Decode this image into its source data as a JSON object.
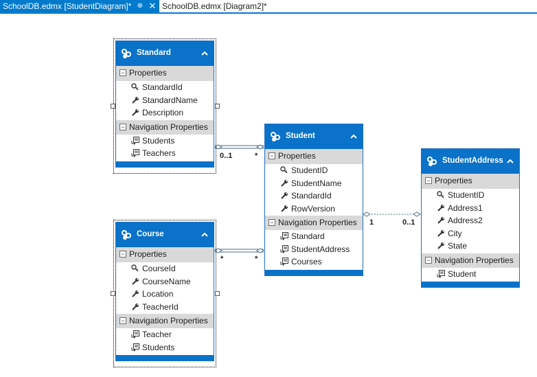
{
  "tabs": {
    "active": {
      "label": "SchoolDB.edmx [StudentDiagram]*",
      "pin_icon": "pin-icon",
      "close_icon": "close-icon"
    },
    "inactive": {
      "label": "SchoolDB.edmx [Diagram2]*"
    }
  },
  "sections": {
    "properties": "Properties",
    "navigation": "Navigation Properties"
  },
  "entities": {
    "standard": {
      "name": "Standard",
      "properties": [
        "StandardId",
        "StandardName",
        "Description"
      ],
      "navigation": [
        "Students",
        "Teachers"
      ]
    },
    "course": {
      "name": "Course",
      "properties": [
        "CourseId",
        "CourseName",
        "Location",
        "TeacherId"
      ],
      "navigation": [
        "Teacher",
        "Students"
      ]
    },
    "student": {
      "name": "Student",
      "properties": [
        "StudentID",
        "StudentName",
        "StandardId",
        "RowVersion"
      ],
      "navigation": [
        "Standard",
        "StudentAddress",
        "Courses"
      ]
    },
    "student_address": {
      "name": "StudentAddress",
      "properties": [
        "StudentID",
        "Address1",
        "Address2",
        "City",
        "State"
      ],
      "navigation": [
        "Student"
      ]
    }
  },
  "associations": {
    "standard_student": {
      "from": "0..1",
      "to": "*"
    },
    "course_student": {
      "from": "*",
      "to": "*"
    },
    "student_address": {
      "from": "1",
      "to": "0..1"
    }
  },
  "colors": {
    "accent": "#007acc",
    "entity_header": "#0a72c9",
    "section": "#d9d9d9"
  }
}
